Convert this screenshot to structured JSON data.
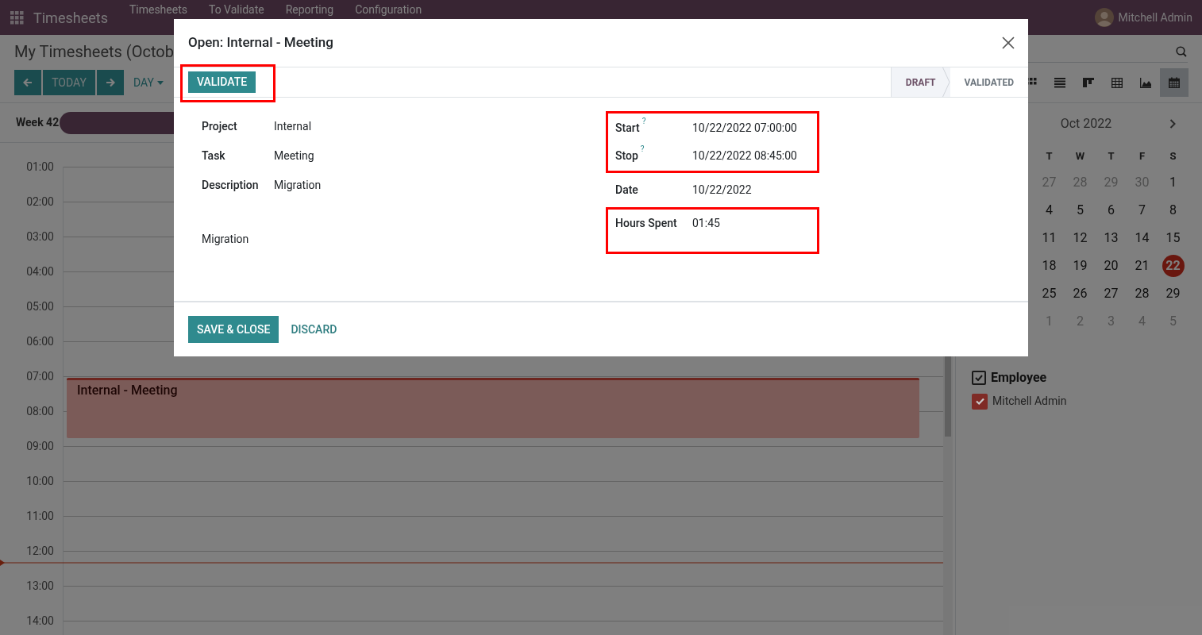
{
  "navbar": {
    "brand": "Timesheets",
    "menu": [
      "Timesheets",
      "To Validate",
      "Reporting",
      "Configuration"
    ],
    "user": "Mitchell Admin"
  },
  "control_panel": {
    "breadcrumb": "My Timesheets (Octob",
    "today_button": "TODAY",
    "scale_button": "DAY",
    "views": [
      {
        "kind": "grid",
        "selected": false
      },
      {
        "kind": "list",
        "selected": false
      },
      {
        "kind": "kanban",
        "selected": false
      },
      {
        "kind": "pivot",
        "selected": false
      },
      {
        "kind": "graph",
        "selected": false
      },
      {
        "kind": "calendar",
        "selected": true
      }
    ]
  },
  "calendar": {
    "week_label": "Week 42",
    "hours": [
      "01:00",
      "02:00",
      "03:00",
      "04:00",
      "05:00",
      "06:00",
      "07:00",
      "08:00",
      "09:00",
      "10:00",
      "11:00",
      "12:00",
      "13:00",
      "14:00"
    ],
    "events": [
      {
        "title": "Internal - Meeting"
      }
    ]
  },
  "sidebar": {
    "month": "Oct 2022",
    "weekdays": [
      "T",
      "W",
      "T",
      "F",
      "S"
    ],
    "weeks": [
      [
        {
          "day": "27",
          "other_month": true,
          "selected": false
        },
        {
          "day": "28",
          "other_month": true,
          "selected": false
        },
        {
          "day": "29",
          "other_month": true,
          "selected": false
        },
        {
          "day": "30",
          "other_month": true,
          "selected": false
        },
        {
          "day": "1",
          "other_month": false,
          "selected": false
        }
      ],
      [
        {
          "day": "4",
          "other_month": false,
          "selected": false
        },
        {
          "day": "5",
          "other_month": false,
          "selected": false
        },
        {
          "day": "6",
          "other_month": false,
          "selected": false
        },
        {
          "day": "7",
          "other_month": false,
          "selected": false
        },
        {
          "day": "8",
          "other_month": false,
          "selected": false
        }
      ],
      [
        {
          "day": "11",
          "other_month": false,
          "selected": false
        },
        {
          "day": "12",
          "other_month": false,
          "selected": false
        },
        {
          "day": "13",
          "other_month": false,
          "selected": false
        },
        {
          "day": "14",
          "other_month": false,
          "selected": false
        },
        {
          "day": "15",
          "other_month": false,
          "selected": false
        }
      ],
      [
        {
          "day": "18",
          "other_month": false,
          "selected": false
        },
        {
          "day": "19",
          "other_month": false,
          "selected": false
        },
        {
          "day": "20",
          "other_month": false,
          "selected": false
        },
        {
          "day": "21",
          "other_month": false,
          "selected": false
        },
        {
          "day": "22",
          "other_month": false,
          "selected": true
        }
      ],
      [
        {
          "day": "25",
          "other_month": false,
          "selected": false
        },
        {
          "day": "26",
          "other_month": false,
          "selected": false
        },
        {
          "day": "27",
          "other_month": false,
          "selected": false
        },
        {
          "day": "28",
          "other_month": false,
          "selected": false
        },
        {
          "day": "29",
          "other_month": false,
          "selected": false
        }
      ],
      [
        {
          "day": "1",
          "other_month": true,
          "selected": false
        },
        {
          "day": "2",
          "other_month": true,
          "selected": false
        },
        {
          "day": "3",
          "other_month": true,
          "selected": false
        },
        {
          "day": "4",
          "other_month": true,
          "selected": false
        },
        {
          "day": "5",
          "other_month": true,
          "selected": false
        }
      ]
    ],
    "filter": {
      "title": "Employee",
      "checked": true,
      "items": [
        {
          "label": "Mitchell Admin",
          "checked": true,
          "color": "#7f2b26"
        }
      ]
    }
  },
  "dialog": {
    "title": "Open: Internal - Meeting",
    "validate_button": {
      "label": "VALIDATE",
      "highlighted": true
    },
    "stages": [
      {
        "label": "DRAFT",
        "selected": true
      },
      {
        "label": "VALIDATED",
        "selected": false
      }
    ],
    "left_fields": [
      {
        "label": "Project",
        "value": "Internal"
      },
      {
        "label": "Task",
        "value": "Meeting"
      },
      {
        "label": "Description",
        "value": "Migration"
      }
    ],
    "note": "Migration",
    "right_groups": [
      {
        "highlighted": true,
        "fields": [
          {
            "label": "Start",
            "help": "?",
            "value": "10/22/2022 07:00:00"
          },
          {
            "label": "Stop",
            "help": "?",
            "value": "10/22/2022 08:45:00"
          }
        ]
      },
      {
        "highlighted": false,
        "fields": [
          {
            "label": "Date",
            "value": "10/22/2022"
          }
        ]
      },
      {
        "highlighted": true,
        "fields": [
          {
            "label": "Hours Spent",
            "value": "01:45"
          }
        ]
      }
    ],
    "footer_buttons": [
      {
        "label": "SAVE & CLOSE",
        "kind": "primary"
      },
      {
        "label": "DISCARD",
        "kind": "link"
      }
    ]
  }
}
